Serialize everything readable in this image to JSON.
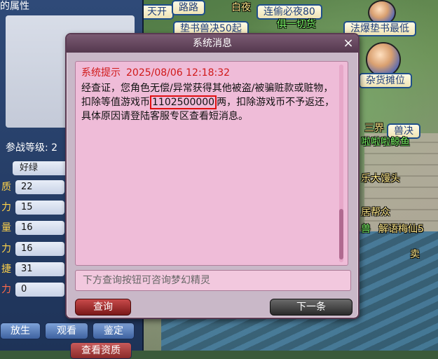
{
  "left_panel": {
    "title_fragment": "的属性",
    "level_label": "参战等级: 2",
    "stats": [
      {
        "key": "",
        "value": "好绿"
      },
      {
        "key": "质",
        "value": "22"
      },
      {
        "key": "力",
        "value": "15"
      },
      {
        "key": "量",
        "value": "16"
      },
      {
        "key": "力",
        "value": "16"
      },
      {
        "key": "捷",
        "value": "31"
      },
      {
        "key": "力",
        "value": "0"
      }
    ],
    "buttons": [
      "放生",
      "观看",
      "鉴定"
    ],
    "bottom_button": "查看资质"
  },
  "scene": {
    "labels": [
      "天开",
      "路路",
      "连偷必夜80",
      "垫书兽决50起",
      "法爆垫书最低",
      "杂货摊位",
      "兽决"
    ],
    "floating_text": [
      "俱一切货",
      "三界",
      "啦啦啦鲸鱼",
      "乐大馒头",
      "居帮众",
      "兽",
      "解语梅仙5",
      "卖",
      "白夜"
    ]
  },
  "dialog": {
    "title": "系统消息",
    "close_glyph": "×",
    "message": {
      "tag": "系统提示",
      "timestamp": "2025/08/06 12:18:32",
      "text_before": "经查证，您角色无偿/异常获得其他被盗/被骗赃款或赃物，扣除等值游戏币",
      "amount": "1102500000",
      "text_after": "两，扣除游戏币不予返还，具体原因请登陆客服专区查看短消息。"
    },
    "input_placeholder": "下方查询按钮可咨询梦幻精灵",
    "query_button": "查询",
    "next_button": "下一条"
  },
  "colors": {
    "dialog_header": "#54384e",
    "message_bg": "#efbcd8",
    "highlight_border": "#e01010",
    "tag_red": "#d01818"
  }
}
